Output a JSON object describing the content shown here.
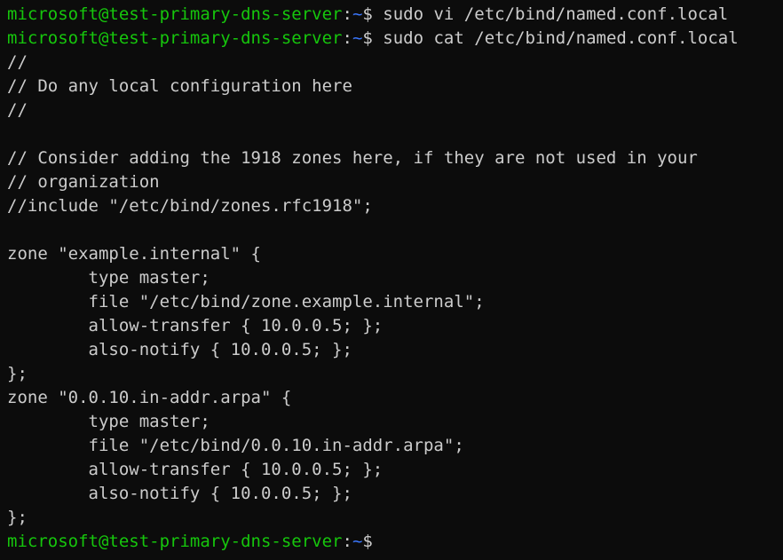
{
  "prompt": {
    "user_host": "microsoft@test-primary-dns-server",
    "colon": ":",
    "path": "~",
    "symbol": "$"
  },
  "commands": [
    " sudo vi /etc/bind/named.conf.local",
    " sudo cat /etc/bind/named.conf.local"
  ],
  "output": [
    "//",
    "// Do any local configuration here",
    "//",
    "",
    "// Consider adding the 1918 zones here, if they are not used in your",
    "// organization",
    "//include \"/etc/bind/zones.rfc1918\";",
    "",
    "zone \"example.internal\" {",
    "        type master;",
    "        file \"/etc/bind/zone.example.internal\";",
    "        allow-transfer { 10.0.0.5; };",
    "        also-notify { 10.0.0.5; };",
    "};",
    "zone \"0.0.10.in-addr.arpa\" {",
    "        type master;",
    "        file \"/etc/bind/0.0.10.in-addr.arpa\";",
    "        allow-transfer { 10.0.0.5; };",
    "        also-notify { 10.0.0.5; };",
    "};"
  ],
  "colors": {
    "background": "#0c0c0c",
    "text": "#cccccc",
    "user_host": "#16c60c",
    "path": "#3b78ff"
  }
}
